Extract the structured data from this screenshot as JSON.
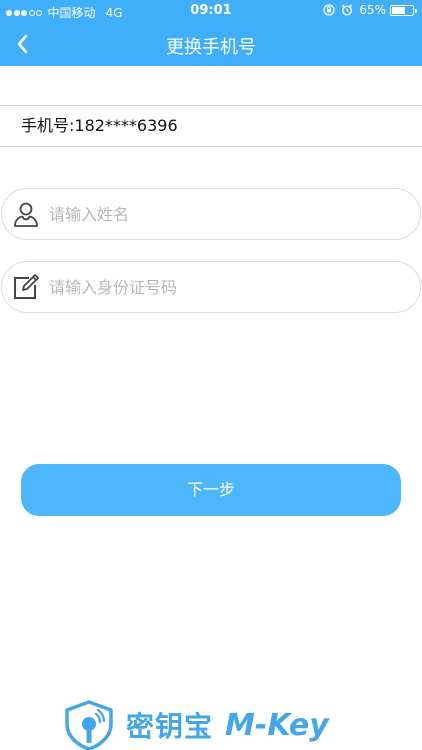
{
  "status_bar": {
    "carrier": "中国移动",
    "network": "4G",
    "time": "09:01",
    "battery": "65%",
    "battery_level": 0.65,
    "signal_bars": 3,
    "signal_total": 5
  },
  "nav": {
    "title": "更换手机号",
    "back_icon": "chevron-left-icon"
  },
  "phone": {
    "text": "手机号:182****6396"
  },
  "form": {
    "name_placeholder": "请输入姓名",
    "name_icon": "user-icon",
    "id_placeholder": "请输入身份证号码",
    "id_icon": "edit-icon"
  },
  "actions": {
    "next_label": "下一步"
  },
  "brand": {
    "cn": "密钥宝",
    "en": "M-Key"
  },
  "colors": {
    "header": "#41aefc",
    "button": "#4cb8fb",
    "brand": "#43a6ea"
  }
}
